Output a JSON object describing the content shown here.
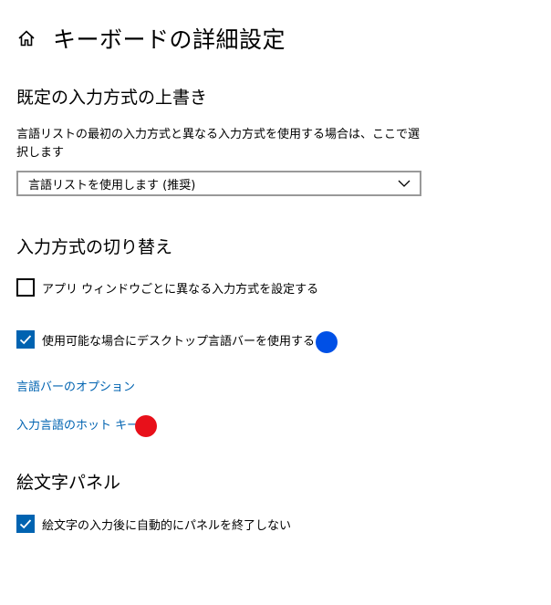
{
  "header": {
    "title": "キーボードの詳細設定",
    "home_icon": "home-icon"
  },
  "override": {
    "section_title": "既定の入力方式の上書き",
    "description": "言語リストの最初の入力方式と異なる入力方式を使用する場合は、ここで選択します",
    "dropdown_value": "言語リストを使用します (推奨)"
  },
  "switching": {
    "section_title": "入力方式の切り替え",
    "per_app_label": "アプリ ウィンドウごとに異なる入力方式を設定する",
    "per_app_checked": false,
    "desktop_bar_label": "使用可能な場合にデスクトップ言語バーを使用する",
    "desktop_bar_checked": true,
    "language_bar_options_link": "言語バーのオプション",
    "hot_keys_link": "入力言語のホット キー"
  },
  "emoji": {
    "section_title": "絵文字パネル",
    "keep_open_label": "絵文字の入力後に自動的にパネルを終了しない",
    "keep_open_checked": true
  },
  "colors": {
    "accent": "#0063b1",
    "marker_blue": "#0050e6",
    "marker_red": "#e8101a"
  }
}
